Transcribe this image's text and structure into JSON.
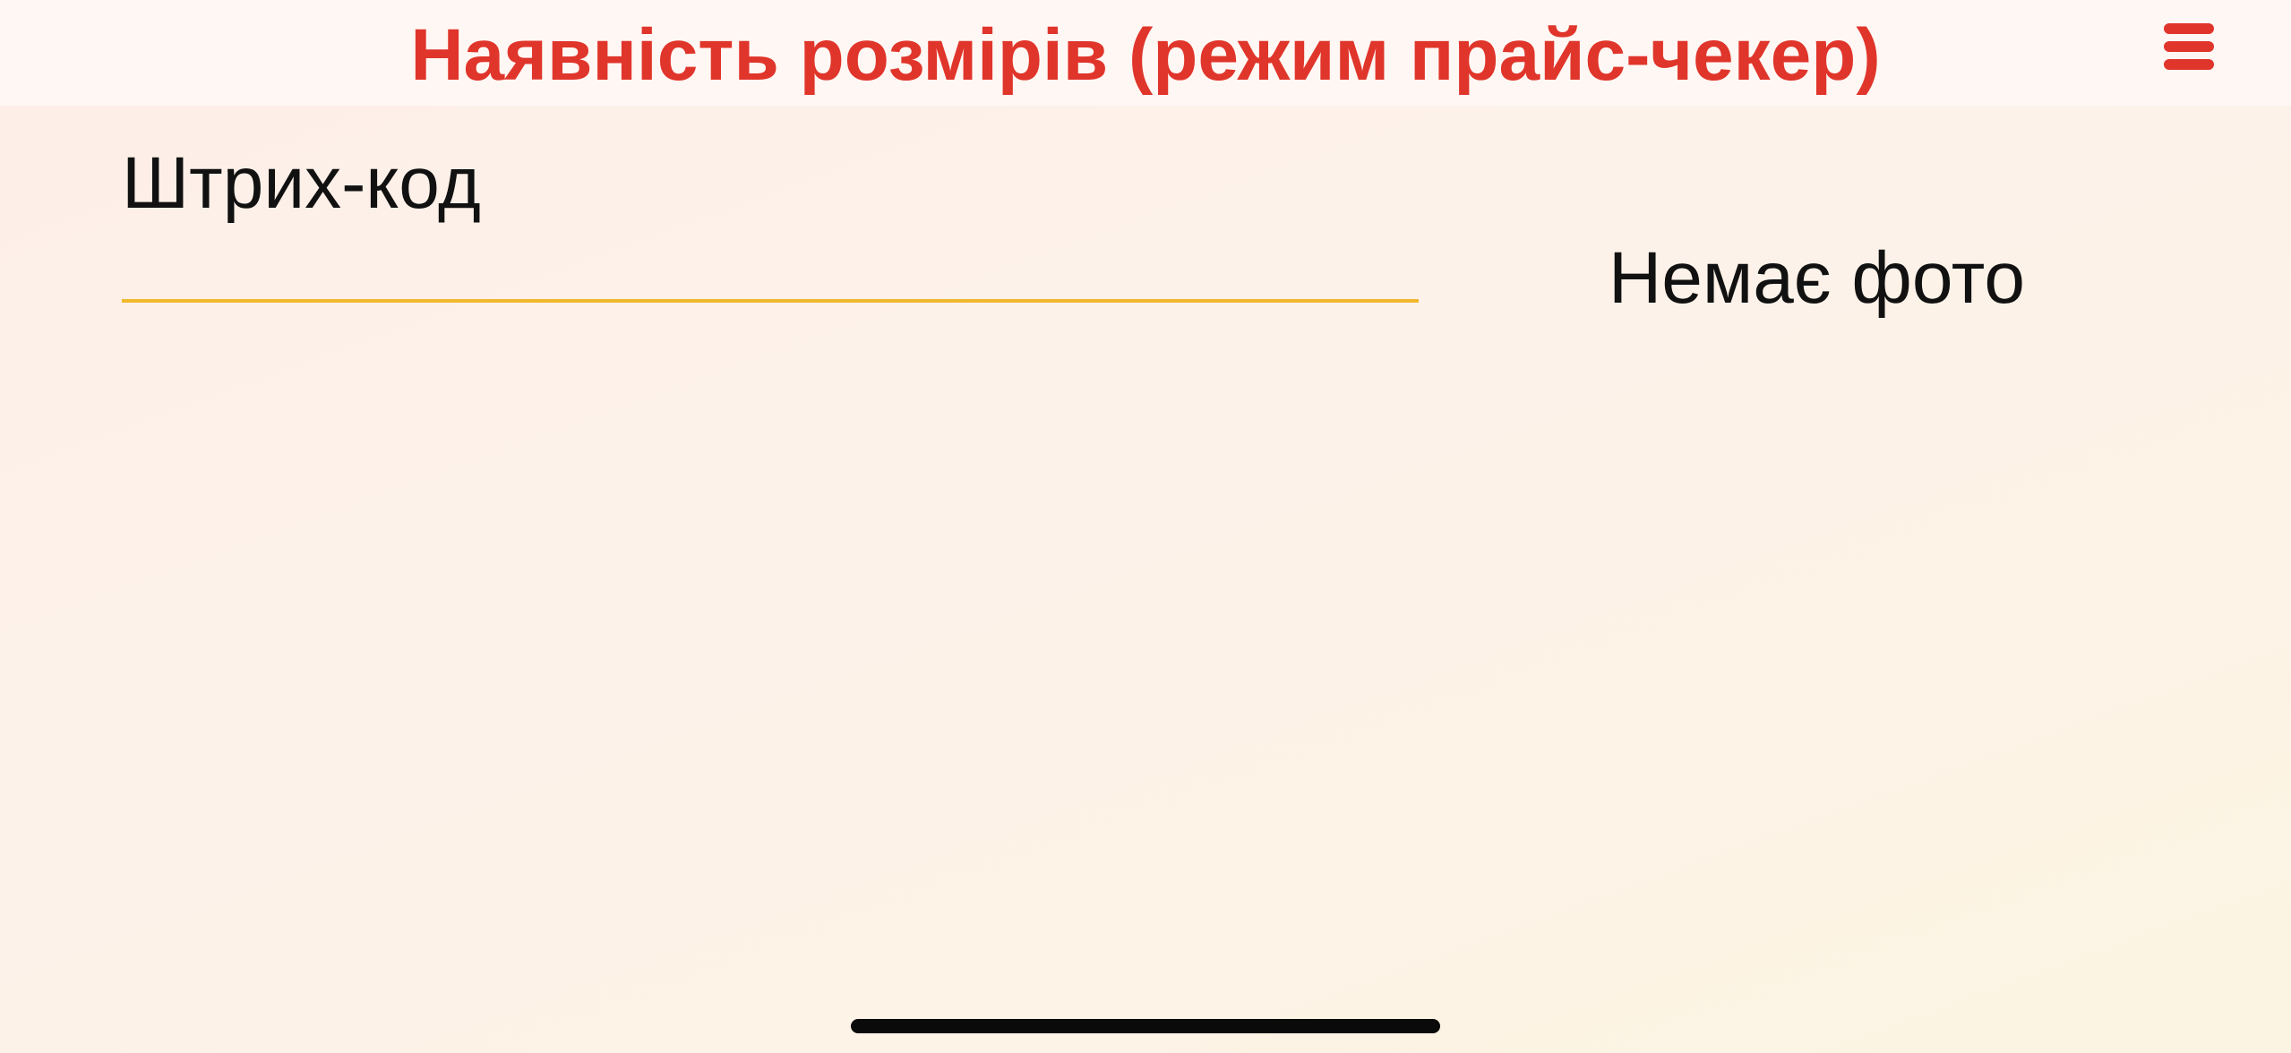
{
  "header": {
    "title": "Наявність розмірів (режим прайс-чекер)",
    "menu_icon": "hamburger-menu-icon"
  },
  "form": {
    "barcode_label": "Штрих-код",
    "barcode_value": "",
    "barcode_placeholder": ""
  },
  "photo": {
    "placeholder_text": "Немає фото"
  },
  "colors": {
    "accent": "#e0352b",
    "input_underline": "#f0b82c",
    "text": "#111111",
    "background": "#fdf1e9"
  }
}
